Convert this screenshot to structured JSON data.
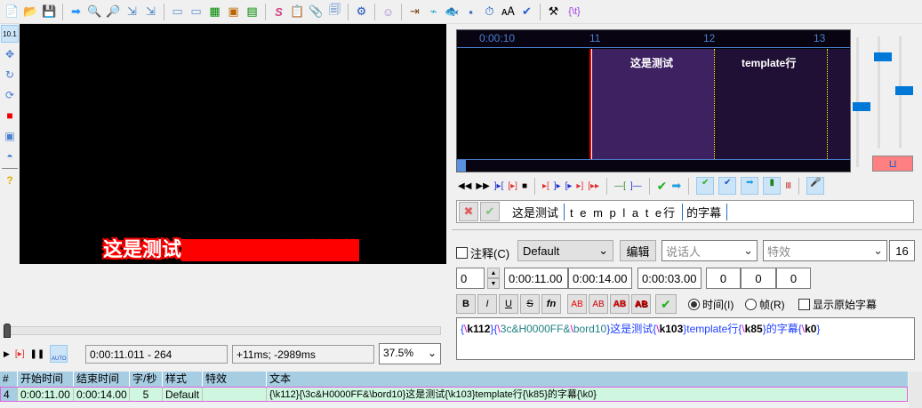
{
  "toolbar": {
    "icons": [
      "new-file",
      "open-file",
      "save-file",
      "jump-to",
      "zoom-in",
      "zoom-out",
      "snap-start",
      "snap-end",
      "set-start",
      "set-end",
      "grid",
      "video-frame",
      "keyframes",
      "styles-manager",
      "properties",
      "attachments",
      "fonts-collector",
      "automation",
      "translation-assistant",
      "resample",
      "timing-post",
      "shift-times",
      "timer",
      "select-lines",
      "spell-check",
      "options",
      "tags-toggle"
    ],
    "tags_label": "{\\t}"
  },
  "video": {
    "subtitle_white": "这是测试",
    "subtitle_red": "template行的字幕",
    "time_display": "0:00:11.011 - 264",
    "offset_display": "+11ms; -2989ms",
    "zoom": "37.5%"
  },
  "audio": {
    "ruler": [
      "0:00:10",
      "11",
      "12",
      "13"
    ],
    "syllables": [
      "这是测试",
      "template行"
    ],
    "karaoke": [
      "这是测试",
      "t e m p l a t e行",
      "的字幕"
    ]
  },
  "edit": {
    "comment_label": "注释(C)",
    "style": "Default",
    "edit_label": "编辑",
    "actor_placeholder": "说话人",
    "effect_placeholder": "特效",
    "chars": "16",
    "layer": "0",
    "start": "0:00:11.00",
    "end": "0:00:14.00",
    "duration": "0:00:03.00",
    "margin_l": "0",
    "margin_r": "0",
    "margin_v": "0",
    "time_radio": "时间(I)",
    "frame_radio": "帧(R)",
    "show_original": "显示原始字幕",
    "fmt": {
      "bold": "B",
      "italic": "I",
      "underline": "U",
      "strike": "S",
      "font": "fn",
      "ab": "AB"
    },
    "text_parts": [
      "{",
      "\\",
      "k112",
      "}{",
      "\\",
      "3c&H0000FF&",
      "\\",
      "bord10",
      "}这是测试{",
      "\\",
      "k103",
      "}template行{",
      "\\",
      "k85",
      "}的字幕{",
      "\\",
      "k0",
      "}"
    ]
  },
  "grid": {
    "headers": [
      "#",
      "开始时间",
      "结束时间",
      "字/秒",
      "样式",
      "特效",
      "文本"
    ],
    "rows": [
      {
        "num": "4",
        "start": "0:00:11.00",
        "end": "0:00:14.00",
        "cps": "5",
        "style": "Default",
        "effect": "",
        "text": "{\\k112}{\\3c&H0000FF&\\bord10}这是测试{\\k103}template行{\\k85}的字幕{\\k0}"
      }
    ]
  }
}
